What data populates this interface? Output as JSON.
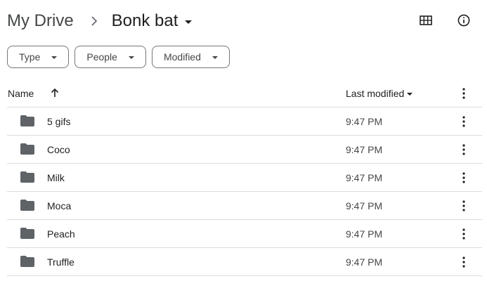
{
  "breadcrumb": {
    "root": "My Drive",
    "current": "Bonk bat"
  },
  "header_actions": [
    {
      "name": "grid-view-icon"
    },
    {
      "name": "info-icon"
    }
  ],
  "filters": [
    {
      "label": "Type"
    },
    {
      "label": "People"
    },
    {
      "label": "Modified"
    }
  ],
  "table": {
    "columns": {
      "name": "Name",
      "modified": "Last modified"
    },
    "sort": {
      "column": "name",
      "direction": "ascending"
    },
    "rows": [
      {
        "name": "5 gifs",
        "modified": "9:47 PM",
        "type": "folder"
      },
      {
        "name": "Coco",
        "modified": "9:47 PM",
        "type": "folder"
      },
      {
        "name": "Milk",
        "modified": "9:47 PM",
        "type": "folder"
      },
      {
        "name": "Moca",
        "modified": "9:47 PM",
        "type": "folder"
      },
      {
        "name": "Peach",
        "modified": "9:47 PM",
        "type": "folder"
      },
      {
        "name": "Truffle",
        "modified": "9:47 PM",
        "type": "folder"
      }
    ]
  },
  "colors": {
    "text": "#1f1f1f",
    "muted": "#444746",
    "divider": "#dadce0",
    "icon": "#5f6368"
  }
}
